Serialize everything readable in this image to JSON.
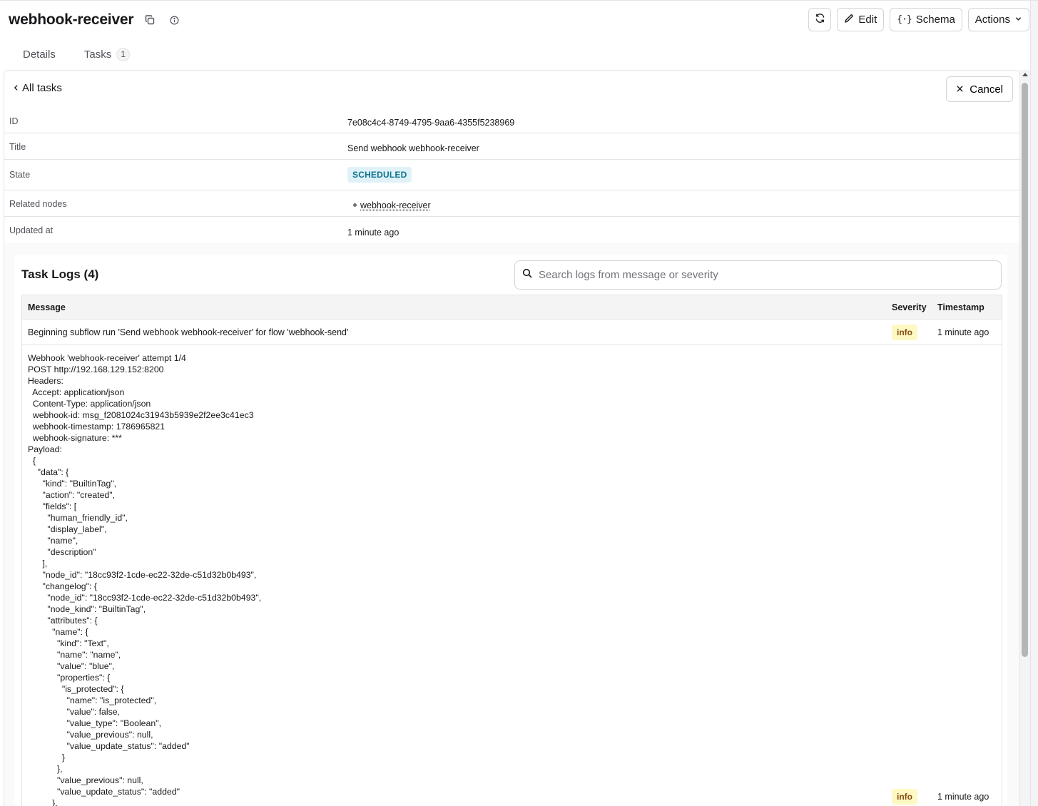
{
  "header": {
    "title": "webhook-receiver",
    "refresh_icon": "refresh-icon",
    "edit_label": "Edit",
    "schema_label": "Schema",
    "actions_label": "Actions"
  },
  "tabs": [
    {
      "label": "Details"
    },
    {
      "label": "Tasks",
      "count": "1"
    }
  ],
  "task": {
    "back_label": "All tasks",
    "cancel_label": "Cancel",
    "properties": {
      "id_label": "ID",
      "id_value": "7e08c4c4-8749-4795-9aa6-4355f5238969",
      "title_label": "Title",
      "title_value": "Send webhook webhook-receiver",
      "state_label": "State",
      "state_value": "SCHEDULED",
      "related_label": "Related nodes",
      "related_value": "webhook-receiver",
      "updated_label": "Updated at",
      "updated_value": "1 minute ago"
    }
  },
  "logs": {
    "title": "Task Logs (4)",
    "search_placeholder": "Search logs from message or severity",
    "columns": {
      "message": "Message",
      "severity": "Severity",
      "timestamp": "Timestamp"
    },
    "rows": [
      {
        "message": "Beginning subflow run 'Send webhook webhook-receiver' for flow 'webhook-send'",
        "severity": "info",
        "timestamp": "1 minute ago"
      },
      {
        "message": "Webhook 'webhook-receiver' attempt 1/4\nPOST http://192.168.129.152:8200\nHeaders:\n  Accept: application/json\n  Content-Type: application/json\n  webhook-id: msg_f2081024c31943b5939e2f2ee3c41ec3\n  webhook-timestamp: 1786965821\n  webhook-signature: ***\nPayload:\n  {\n    \"data\": {\n      \"kind\": \"BuiltinTag\",\n      \"action\": \"created\",\n      \"fields\": [\n        \"human_friendly_id\",\n        \"display_label\",\n        \"name\",\n        \"description\"\n      ],\n      \"node_id\": \"18cc93f2-1cde-ec22-32de-c51d32b0b493\",\n      \"changelog\": {\n        \"node_id\": \"18cc93f2-1cde-ec22-32de-c51d32b0b493\",\n        \"node_kind\": \"BuiltinTag\",\n        \"attributes\": {\n          \"name\": {\n            \"kind\": \"Text\",\n            \"name\": \"name\",\n            \"value\": \"blue\",\n            \"properties\": {\n              \"is_protected\": {\n                \"name\": \"is_protected\",\n                \"value\": false,\n                \"value_type\": \"Boolean\",\n                \"value_previous\": null,\n                \"value_update_status\": \"added\"\n              }\n            },\n            \"value_previous\": null,\n            \"value_update_status\": \"added\"\n          },",
        "severity": "info",
        "timestamp": "1 minute ago"
      }
    ]
  }
}
